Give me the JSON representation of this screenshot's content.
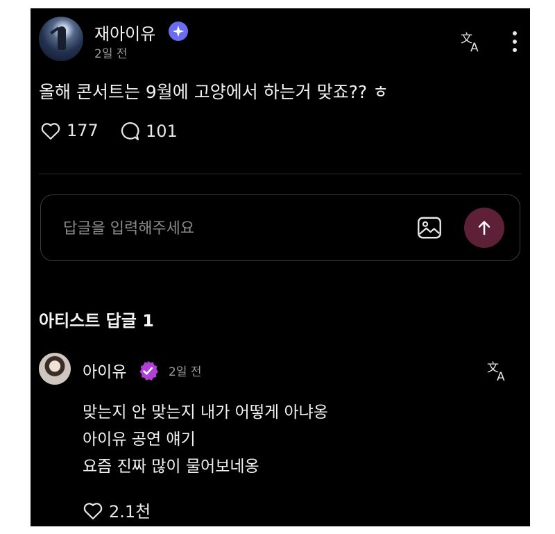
{
  "post": {
    "author": "재아이유",
    "time": "2일 전",
    "text": "올해 콘서트는 9월에 고양에서 하는거 맞죠?? ㅎ",
    "likes": "177",
    "comments": "101",
    "icons": {
      "verified": "verified-sparkle-icon",
      "translate": "translate-icon",
      "more": "more-vertical-icon",
      "like": "heart-outline-icon",
      "comment": "speech-bubble-icon"
    }
  },
  "reply_box": {
    "placeholder": "답글을 입력해주세요",
    "icons": {
      "image": "image-icon",
      "send": "arrow-up-icon"
    }
  },
  "artist_replies": {
    "title": "아티스트 답글 1",
    "items": [
      {
        "author": "아이유",
        "time": "2일 전",
        "lines": [
          "맞는지 안 맞는지 내가 어떻게 아냐옹",
          "아이유 공연 얘기",
          "요즘 진짜 많이 물어보네옹"
        ],
        "likes": "2.1천"
      }
    ]
  },
  "colors": {
    "background": "#000000",
    "verified_blue": "#6a6df0",
    "artist_badge_purple": "#b23fd8",
    "send_button": "#5e2037"
  }
}
